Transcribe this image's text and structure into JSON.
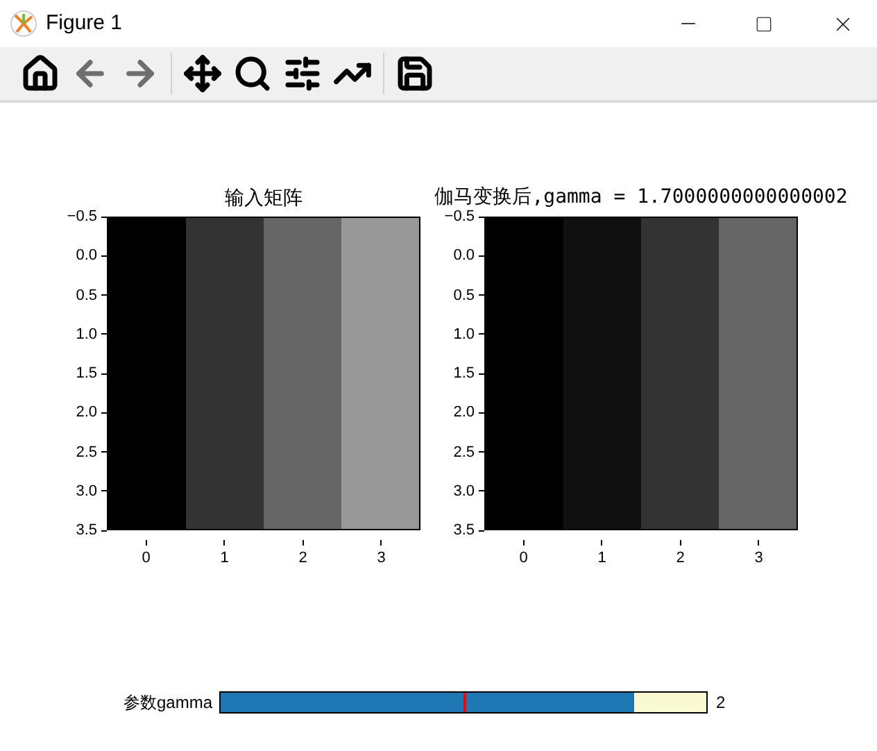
{
  "window": {
    "title": "Figure 1"
  },
  "toolbar": [
    {
      "kind": "home",
      "disabled": false
    },
    {
      "kind": "back",
      "disabled": true
    },
    {
      "kind": "forward",
      "disabled": true
    },
    {
      "kind": "pan",
      "disabled": false
    },
    {
      "kind": "zoom",
      "disabled": false
    },
    {
      "kind": "subplots",
      "disabled": false
    },
    {
      "kind": "axes",
      "disabled": false
    },
    {
      "kind": "save",
      "disabled": false
    }
  ],
  "plots": [
    {
      "title": "输入矩阵",
      "yticks": [
        "−0.5",
        "0.0",
        "0.5",
        "1.0",
        "1.5",
        "2.0",
        "2.5",
        "3.0",
        "3.5"
      ],
      "xticks": [
        "0",
        "1",
        "2",
        "3"
      ],
      "cells": [
        {
          "color": "#000000"
        },
        {
          "color": "#333333"
        },
        {
          "color": "#666666"
        },
        {
          "color": "#999999"
        }
      ]
    },
    {
      "title": "伽马变换后,gamma = 1.7000000000000002",
      "yticks": [
        "−0.5",
        "0.0",
        "0.5",
        "1.0",
        "1.5",
        "2.0",
        "2.5",
        "3.0",
        "3.5"
      ],
      "xticks": [
        "0",
        "1",
        "2",
        "3"
      ],
      "cells": [
        {
          "color": "#000000"
        },
        {
          "color": "#101010"
        },
        {
          "color": "#333333"
        },
        {
          "color": "#666666"
        }
      ]
    }
  ],
  "slider": {
    "label": "参数gamma",
    "level": 0.85,
    "initial_marker": {
      "level": 0.5
    },
    "reading": "2"
  }
}
